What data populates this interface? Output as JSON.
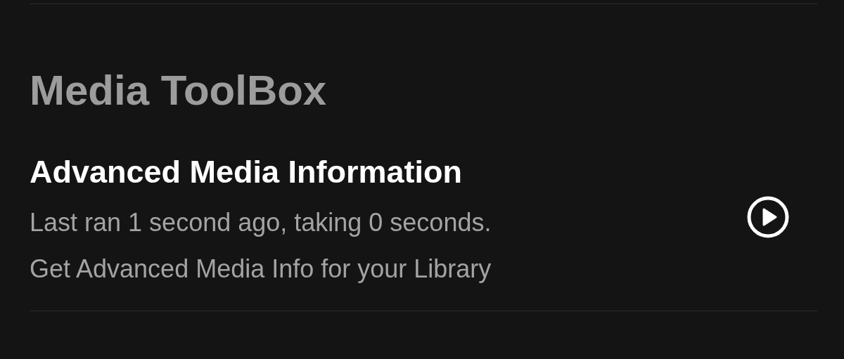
{
  "section": {
    "title": "Media ToolBox"
  },
  "tasks": [
    {
      "title": "Advanced Media Information",
      "status": "Last ran 1 second ago, taking 0 seconds.",
      "description": "Get Advanced Media Info for your Library"
    }
  ]
}
